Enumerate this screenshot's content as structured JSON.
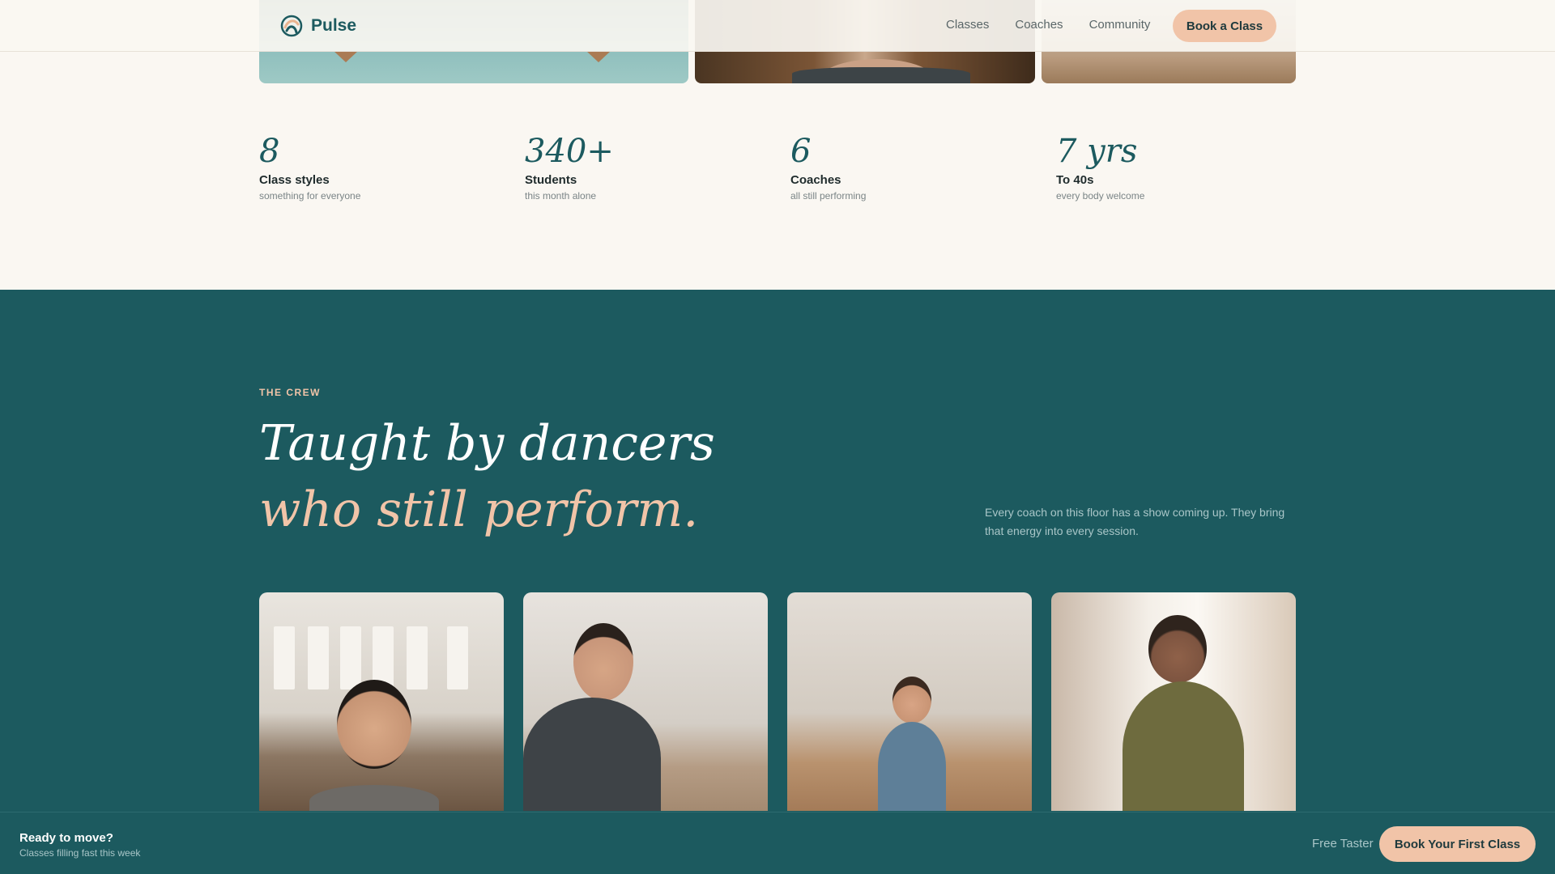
{
  "nav": {
    "brand": "Pulse",
    "links": [
      "Classes",
      "Coaches",
      "Community"
    ],
    "cta": "Book a Class"
  },
  "stats": [
    {
      "value": "8",
      "label": "Class styles",
      "sub": "something for everyone"
    },
    {
      "value": "340+",
      "label": "Students",
      "sub": "this month alone"
    },
    {
      "value": "6",
      "label": "Coaches",
      "sub": "all still performing"
    },
    {
      "value": "7 yrs",
      "label": "To 40s",
      "sub": "every body welcome"
    }
  ],
  "crew": {
    "eyebrow": "THE CREW",
    "headline_line1": "Taught by dancers",
    "headline_line2": "who still perform.",
    "description": "Every coach on this floor has a show coming up. They bring that energy into every session."
  },
  "sticky_bar": {
    "title": "Ready to move?",
    "subtitle": "Classes filling fast this week",
    "link": "Free Taster",
    "cta": "Book Your First Class"
  },
  "colors": {
    "teal": "#1c5a5f",
    "peach": "#f1c4a8",
    "cream": "#faf7f2"
  }
}
